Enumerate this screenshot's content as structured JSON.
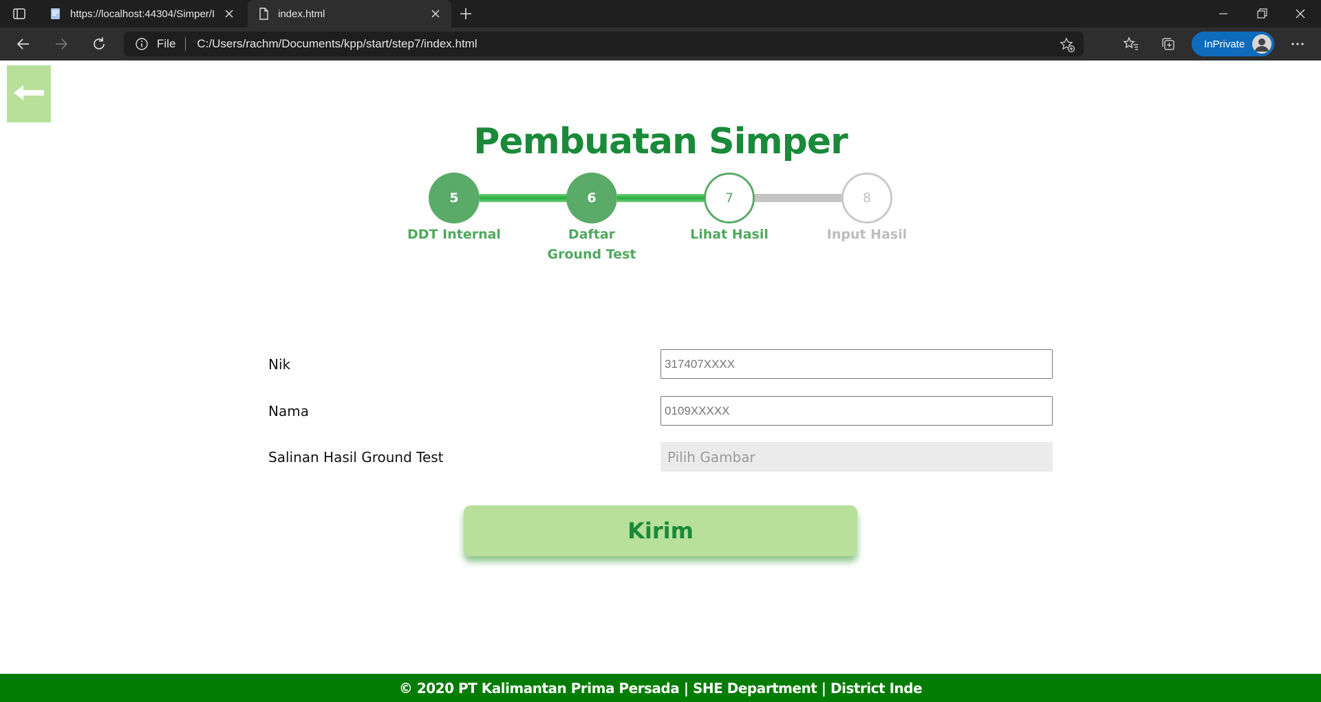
{
  "browser": {
    "tabs": [
      {
        "title": "https://localhost:44304/Simper/I",
        "active": false
      },
      {
        "title": "index.html",
        "active": true
      }
    ],
    "address": {
      "scheme_label": "File",
      "url": "C:/Users/rachm/Documents/kpp/start/step7/index.html"
    },
    "inprivate_label": "InPrivate"
  },
  "page": {
    "title": "Pembuatan Simper",
    "steps": [
      {
        "number": "5",
        "label": "DDT Internal",
        "state": "done"
      },
      {
        "number": "6",
        "label_line1": "Daftar",
        "label_line2": "Ground Test",
        "state": "done"
      },
      {
        "number": "7",
        "label": "Lihat Hasil",
        "state": "current"
      },
      {
        "number": "8",
        "label": "Input Hasil",
        "state": "todo"
      }
    ],
    "form": {
      "nik": {
        "label": "Nik",
        "placeholder": "317407XXXX"
      },
      "nama": {
        "label": "Nama",
        "placeholder": "0109XXXXX"
      },
      "salinan": {
        "label": "Salinan Hasil Ground Test",
        "picker_text": "Pilih Gambar"
      }
    },
    "submit_label": "Kirim",
    "footer_text": "© 2020 PT Kalimantan Prima Persada | SHE Department | District Inde"
  },
  "colors": {
    "brand_green": "#1a8a3a",
    "step_green": "#5aaa68",
    "light_green": "#b8e09b",
    "footer_green": "#037c03",
    "inprivate_blue": "#0f6cbd"
  }
}
